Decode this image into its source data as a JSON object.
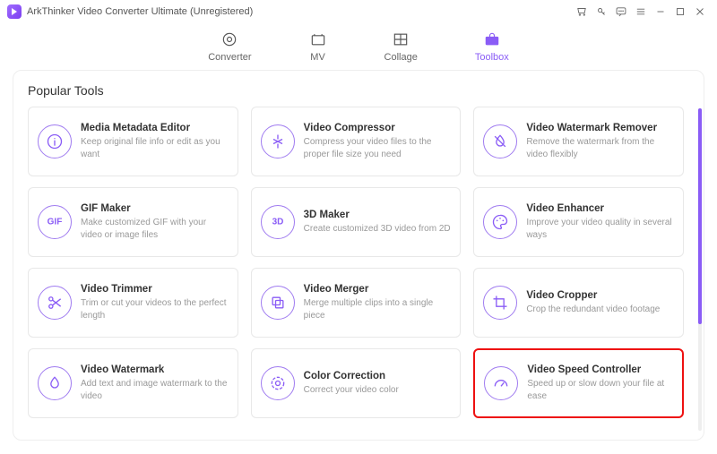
{
  "app": {
    "title": "ArkThinker Video Converter Ultimate (Unregistered)"
  },
  "tabs": {
    "converter": "Converter",
    "mv": "MV",
    "collage": "Collage",
    "toolbox": "Toolbox"
  },
  "section_title": "Popular Tools",
  "tools": {
    "metadata": {
      "title": "Media Metadata Editor",
      "desc": "Keep original file info or edit as you want"
    },
    "compressor": {
      "title": "Video Compressor",
      "desc": "Compress your video files to the proper file size you need"
    },
    "watermark_remover": {
      "title": "Video Watermark Remover",
      "desc": "Remove the watermark from the video flexibly"
    },
    "gif": {
      "title": "GIF Maker",
      "desc": "Make customized GIF with your video or image files"
    },
    "threeD": {
      "title": "3D Maker",
      "desc": "Create customized 3D video from 2D"
    },
    "enhancer": {
      "title": "Video Enhancer",
      "desc": "Improve your video quality in several ways"
    },
    "trimmer": {
      "title": "Video Trimmer",
      "desc": "Trim or cut your videos to the perfect length"
    },
    "merger": {
      "title": "Video Merger",
      "desc": "Merge multiple clips into a single piece"
    },
    "cropper": {
      "title": "Video Cropper",
      "desc": "Crop the redundant video footage"
    },
    "watermark": {
      "title": "Video Watermark",
      "desc": "Add text and image watermark to the video"
    },
    "color": {
      "title": "Color Correction",
      "desc": "Correct your video color"
    },
    "speed": {
      "title": "Video Speed Controller",
      "desc": "Speed up or slow down your file at ease"
    }
  },
  "icons": {
    "gif_label": "GIF",
    "threeD_label": "3D"
  }
}
